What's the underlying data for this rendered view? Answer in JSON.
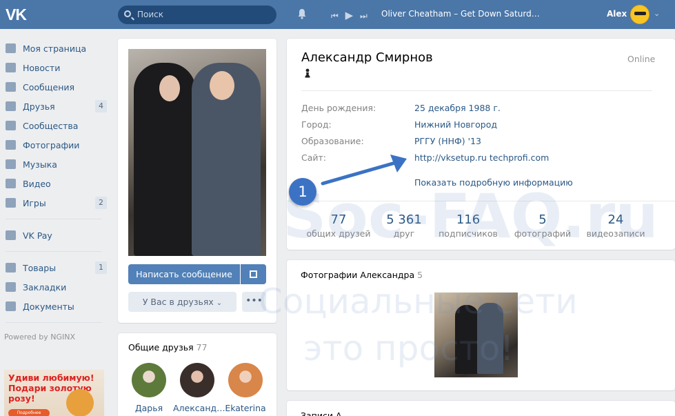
{
  "header": {
    "logo": "VK",
    "search_placeholder": "Поиск",
    "now_playing": "Oliver Cheatham – Get Down Saturd…",
    "user_name": "Alex"
  },
  "sidebar": {
    "items": [
      {
        "label": "Моя страница",
        "icon": "home-icon"
      },
      {
        "label": "Новости",
        "icon": "news-icon"
      },
      {
        "label": "Сообщения",
        "icon": "messages-icon"
      },
      {
        "label": "Друзья",
        "icon": "friends-icon",
        "count": "4"
      },
      {
        "label": "Сообщества",
        "icon": "groups-icon"
      },
      {
        "label": "Фотографии",
        "icon": "camera-icon"
      },
      {
        "label": "Музыка",
        "icon": "music-icon"
      },
      {
        "label": "Видео",
        "icon": "video-icon"
      },
      {
        "label": "Игры",
        "icon": "gamepad-icon",
        "count": "2"
      }
    ],
    "items2": [
      {
        "label": "VK Pay",
        "icon": "vkpay-icon"
      }
    ],
    "items3": [
      {
        "label": "Товары",
        "icon": "bag-icon",
        "count": "1"
      },
      {
        "label": "Закладки",
        "icon": "star-icon"
      },
      {
        "label": "Документы",
        "icon": "document-icon"
      }
    ],
    "powered": "Powered by NGINX",
    "ad_text": "Удиви любимую! Подари золотую розу!",
    "ad_button": "Подробнее"
  },
  "profile": {
    "send_message": "Написать сообщение",
    "friends_status": "У Вас в друзьях",
    "more": "•••",
    "name": "Александр Смирнов",
    "online": "Online",
    "rows": [
      {
        "label": "День рождения:",
        "value": "25 декабря 1988 г."
      },
      {
        "label": "Город:",
        "value": "Нижний Новгород"
      },
      {
        "label": "Образование:",
        "value": "РГГУ (ННФ) '13"
      },
      {
        "label": "Сайт:",
        "value": "http://vksetup.ru techprofi.com"
      }
    ],
    "show_more": "Показать подробную информацию",
    "counters": [
      {
        "num": "77",
        "label": "общих друзей"
      },
      {
        "num": "5 361",
        "label": "друг"
      },
      {
        "num": "116",
        "label": "подписчиков"
      },
      {
        "num": "5",
        "label": "фотографий"
      },
      {
        "num": "24",
        "label": "видеозаписи"
      }
    ]
  },
  "mutual": {
    "title": "Общие друзья",
    "count": "77",
    "friends": [
      {
        "name": "Дарья"
      },
      {
        "name": "Александ…"
      },
      {
        "name": "Ekaterina"
      }
    ]
  },
  "photos": {
    "title": "Фотографии Александра",
    "count": "5"
  },
  "bottom": {
    "title": "Записи А…"
  },
  "annotation": {
    "badge": "1"
  },
  "watermark": {
    "line1": "Soc-FAQ.ru",
    "line2": "Социальные сети",
    "line3": "это просто!"
  },
  "colors": {
    "header": "#4a76a8",
    "link": "#2a5885",
    "button": "#5181b8",
    "badge": "#3b72c4"
  }
}
